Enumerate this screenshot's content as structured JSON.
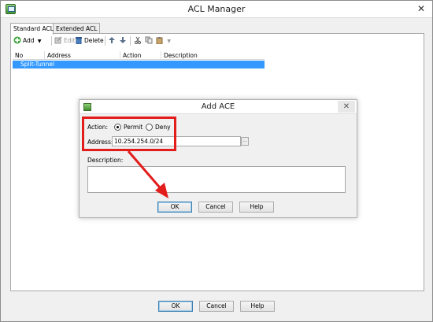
{
  "window": {
    "title": "ACL Manager"
  },
  "tabs": [
    {
      "label": "Standard ACL",
      "active": true
    },
    {
      "label": "Extended ACL",
      "active": false
    }
  ],
  "toolbar": {
    "add_label": "Add",
    "edit_label": "Edit",
    "delete_label": "Delete"
  },
  "table": {
    "columns": [
      "No",
      "Address",
      "Action",
      "Description"
    ],
    "rows": [
      {
        "label": "Split-Tunnel",
        "selected": true
      }
    ]
  },
  "footer": {
    "ok_label": "OK",
    "cancel_label": "Cancel",
    "help_label": "Help"
  },
  "dialog": {
    "title": "Add ACE",
    "action_label": "Action:",
    "permit_label": "Permit",
    "deny_label": "Deny",
    "selected_action": "Permit",
    "address_label": "Address:",
    "address_value": "10.254.254.0/24",
    "description_label": "Description:",
    "description_value": "",
    "ok_label": "OK",
    "cancel_label": "Cancel",
    "help_label": "Help"
  },
  "annotation": {
    "highlight_color": "#e31c1c"
  },
  "colors": {
    "selection": "#3399ff"
  }
}
